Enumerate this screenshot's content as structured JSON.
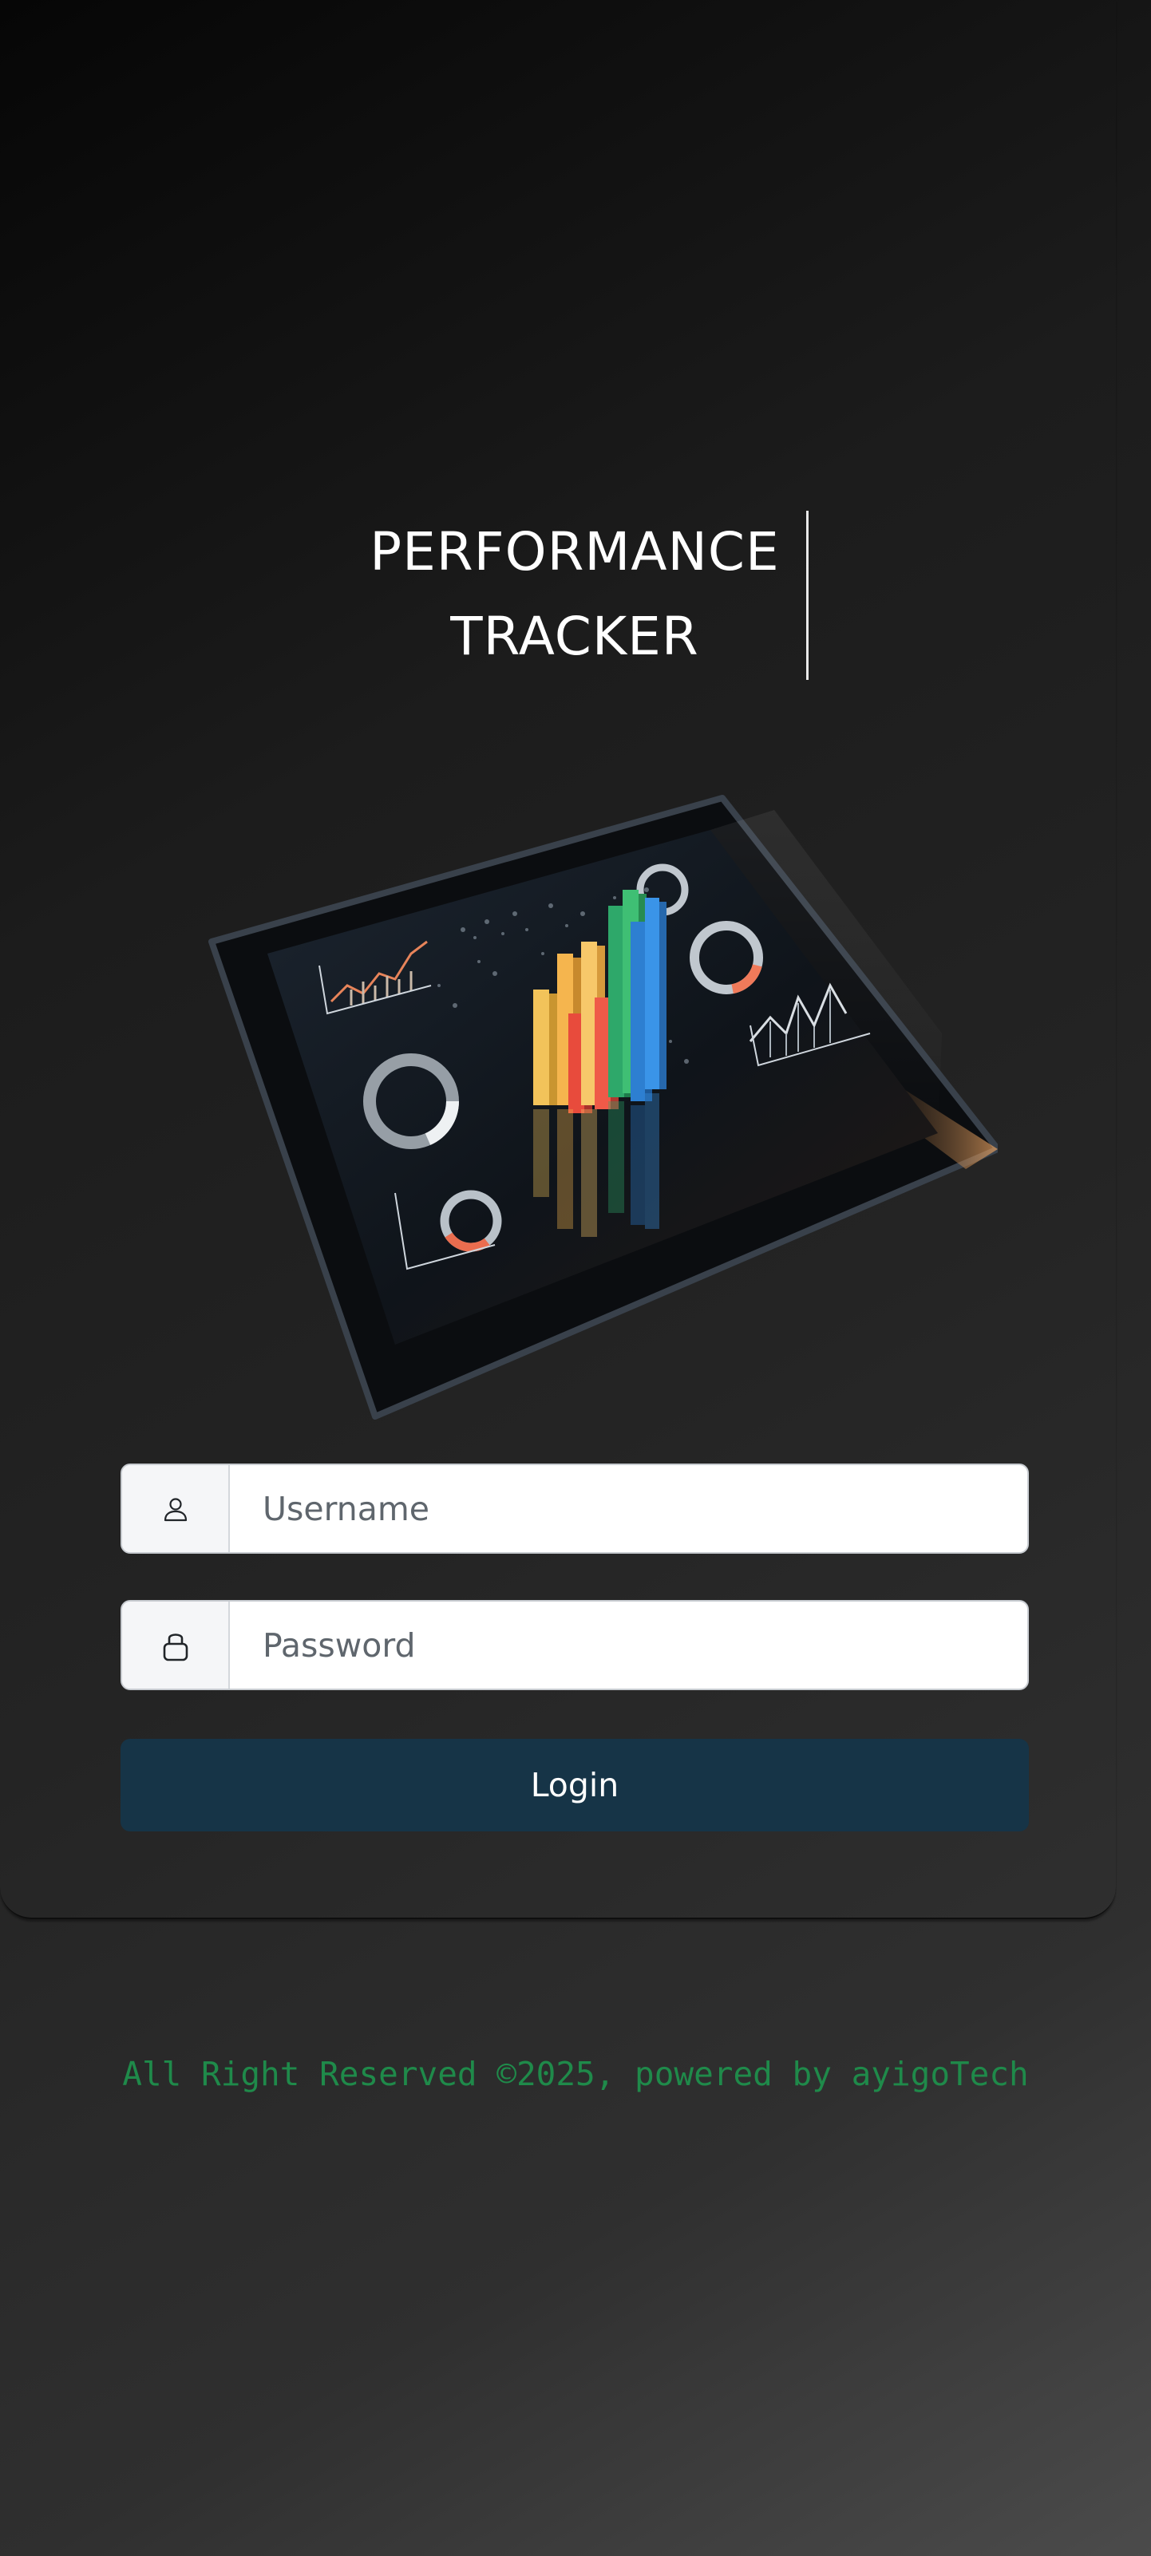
{
  "app": {
    "title_line1": "PERFORMANCE",
    "title_line2": "TRACKER"
  },
  "hero": {
    "icon": "tablet-dashboard-illustration"
  },
  "form": {
    "username": {
      "icon": "user-icon",
      "value": "",
      "placeholder": "Username"
    },
    "password": {
      "icon": "lock-icon",
      "value": "",
      "placeholder": "Password"
    },
    "login_label": "Login"
  },
  "footer": {
    "text": "All Right Reserved ©2025, powered by ayigoTech"
  },
  "colors": {
    "button": "#163447",
    "footer_text": "#1f8a4a",
    "title_text": "#ffffff"
  }
}
